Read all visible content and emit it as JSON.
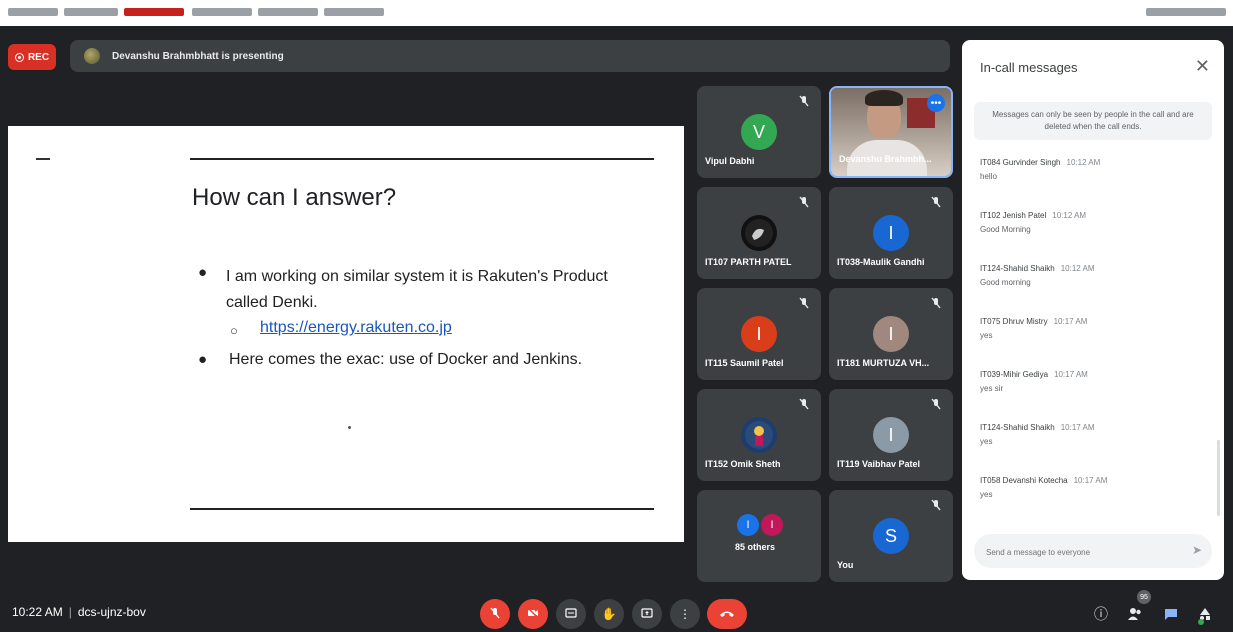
{
  "rec_label": "REC",
  "presenting_text": "Devanshu Brahmbhatt is presenting",
  "slide": {
    "title": "How can I answer?",
    "bullet1": "I am working on similar system it is Rakuten's Product called Denki.",
    "subbullet_link": "https://energy.rakuten.co.jp",
    "bullet2": "Here comes the exac: use of Docker and Jenkins."
  },
  "tiles": [
    {
      "name": "Vipul Dabhi",
      "initial": "V",
      "color": "#33a852"
    },
    {
      "name": "Devanshu Brahmbh..."
    },
    {
      "name": "IT107 PARTH PATEL"
    },
    {
      "name": "IT038-Maulik Gandhi",
      "initial": "I",
      "color": "#1967d2"
    },
    {
      "name": "IT115 Saumil Patel",
      "initial": "I",
      "color": "#d93d1a"
    },
    {
      "name": "IT181 MURTUZA VH...",
      "initial": "I",
      "color": "#a1887f"
    },
    {
      "name": "IT152 Omik Sheth"
    },
    {
      "name": "IT119 Vaibhav Patel",
      "initial": "I",
      "color": "#8a9aa6"
    },
    {
      "name": "85 others",
      "initials": [
        "I",
        "I"
      ],
      "colors": [
        "#1a73e8",
        "#c2185b"
      ]
    },
    {
      "name": "You",
      "initial": "S",
      "color": "#1967d2"
    }
  ],
  "chat": {
    "title": "In-call messages",
    "notice": "Messages can only be seen by people in the call and are deleted when the call ends.",
    "messages": [
      {
        "sender": "IT084 Gurvinder Singh",
        "time": "10:12 AM",
        "body": "hello"
      },
      {
        "sender": "IT102 Jenish Patel",
        "time": "10:12 AM",
        "body": "Good Morning"
      },
      {
        "sender": "IT124-Shahid Shaikh",
        "time": "10:12 AM",
        "body": "Good morning"
      },
      {
        "sender": "IT075 Dhruv Mistry",
        "time": "10:17 AM",
        "body": "yes"
      },
      {
        "sender": "IT039-Mihir Gediya",
        "time": "10:17 AM",
        "body": "yes sir"
      },
      {
        "sender": "IT124-Shahid Shaikh",
        "time": "10:17 AM",
        "body": "yes"
      },
      {
        "sender": "IT058 Devanshi Kotecha",
        "time": "10:17 AM",
        "body": "yes"
      }
    ],
    "input_placeholder": "Send a message to everyone"
  },
  "bottom": {
    "time": "10:22 AM",
    "meeting_code": "dcs-ujnz-bov",
    "participant_count": "95"
  },
  "icons": {
    "mic_off": "mic-off-icon",
    "camera_off": "camera-off-icon",
    "captions": "captions-icon",
    "raise_hand": "hand-icon",
    "present": "present-icon",
    "more": "more-vert-icon",
    "hangup": "phone-hangup-icon",
    "info": "info-icon",
    "people": "people-icon",
    "chat": "chat-icon",
    "activities": "activities-icon"
  },
  "colors": {
    "background": "#202124",
    "tile": "#3c4043",
    "danger": "#ea4335",
    "accent": "#1a73e8"
  }
}
